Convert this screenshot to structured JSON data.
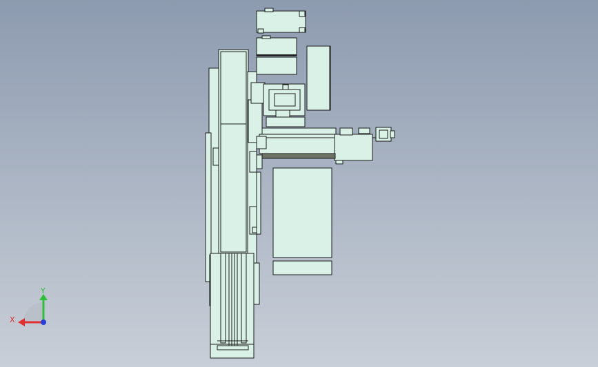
{
  "viewport": {
    "background_top": "#8d9bb0",
    "background_bottom": "#c9cfd8"
  },
  "model": {
    "face_color": "#d9f1e7",
    "edge_color": "#1a1a1a",
    "dark_band_color": "#6d7466"
  },
  "triad": {
    "x_label": "X",
    "y_label": "Y",
    "x_color": "#e03030",
    "y_color": "#2fbf3a",
    "z_color": "#2a3fd8"
  }
}
